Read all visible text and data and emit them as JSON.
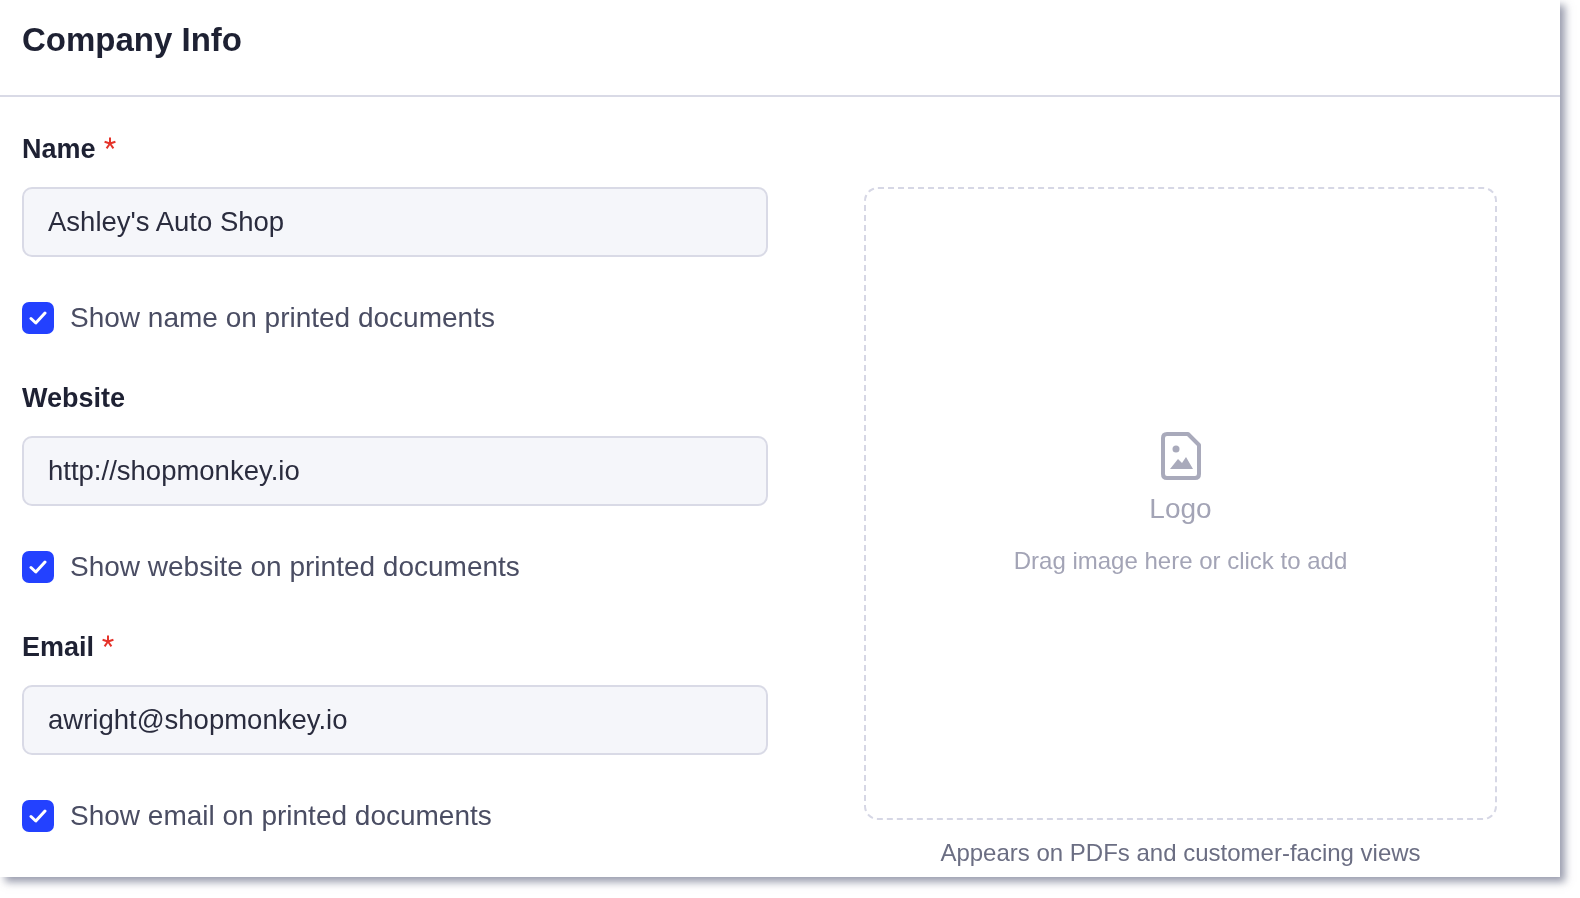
{
  "panel": {
    "title": "Company Info"
  },
  "fields": [
    {
      "label": "Name",
      "required": true,
      "value": "Ashley's Auto Shop",
      "print_option": {
        "label": "Show name on printed documents",
        "checked": true
      }
    },
    {
      "label": "Website",
      "required": false,
      "value": "http://shopmonkey.io",
      "print_option": {
        "label": "Show website on printed documents",
        "checked": true
      }
    },
    {
      "label": "Email",
      "required": true,
      "value": "awright@shopmonkey.io",
      "print_option": {
        "label": "Show email on printed documents",
        "checked": true
      }
    }
  ],
  "logo_upload": {
    "title": "Logo",
    "hint": "Drag image here or click to add",
    "caption": "Appears on PDFs and customer-facing views"
  }
}
